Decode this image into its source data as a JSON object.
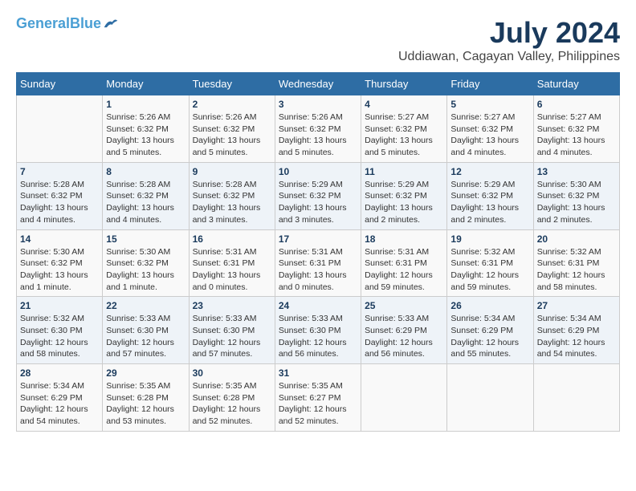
{
  "logo": {
    "line1": "General",
    "line2": "Blue"
  },
  "title": "July 2024",
  "subtitle": "Uddiawan, Cagayan Valley, Philippines",
  "header_days": [
    "Sunday",
    "Monday",
    "Tuesday",
    "Wednesday",
    "Thursday",
    "Friday",
    "Saturday"
  ],
  "weeks": [
    [
      {
        "day": "",
        "sunrise": "",
        "sunset": "",
        "daylight": ""
      },
      {
        "day": "1",
        "sunrise": "Sunrise: 5:26 AM",
        "sunset": "Sunset: 6:32 PM",
        "daylight": "Daylight: 13 hours and 5 minutes."
      },
      {
        "day": "2",
        "sunrise": "Sunrise: 5:26 AM",
        "sunset": "Sunset: 6:32 PM",
        "daylight": "Daylight: 13 hours and 5 minutes."
      },
      {
        "day": "3",
        "sunrise": "Sunrise: 5:26 AM",
        "sunset": "Sunset: 6:32 PM",
        "daylight": "Daylight: 13 hours and 5 minutes."
      },
      {
        "day": "4",
        "sunrise": "Sunrise: 5:27 AM",
        "sunset": "Sunset: 6:32 PM",
        "daylight": "Daylight: 13 hours and 5 minutes."
      },
      {
        "day": "5",
        "sunrise": "Sunrise: 5:27 AM",
        "sunset": "Sunset: 6:32 PM",
        "daylight": "Daylight: 13 hours and 4 minutes."
      },
      {
        "day": "6",
        "sunrise": "Sunrise: 5:27 AM",
        "sunset": "Sunset: 6:32 PM",
        "daylight": "Daylight: 13 hours and 4 minutes."
      }
    ],
    [
      {
        "day": "7",
        "sunrise": "Sunrise: 5:28 AM",
        "sunset": "Sunset: 6:32 PM",
        "daylight": "Daylight: 13 hours and 4 minutes."
      },
      {
        "day": "8",
        "sunrise": "Sunrise: 5:28 AM",
        "sunset": "Sunset: 6:32 PM",
        "daylight": "Daylight: 13 hours and 4 minutes."
      },
      {
        "day": "9",
        "sunrise": "Sunrise: 5:28 AM",
        "sunset": "Sunset: 6:32 PM",
        "daylight": "Daylight: 13 hours and 3 minutes."
      },
      {
        "day": "10",
        "sunrise": "Sunrise: 5:29 AM",
        "sunset": "Sunset: 6:32 PM",
        "daylight": "Daylight: 13 hours and 3 minutes."
      },
      {
        "day": "11",
        "sunrise": "Sunrise: 5:29 AM",
        "sunset": "Sunset: 6:32 PM",
        "daylight": "Daylight: 13 hours and 2 minutes."
      },
      {
        "day": "12",
        "sunrise": "Sunrise: 5:29 AM",
        "sunset": "Sunset: 6:32 PM",
        "daylight": "Daylight: 13 hours and 2 minutes."
      },
      {
        "day": "13",
        "sunrise": "Sunrise: 5:30 AM",
        "sunset": "Sunset: 6:32 PM",
        "daylight": "Daylight: 13 hours and 2 minutes."
      }
    ],
    [
      {
        "day": "14",
        "sunrise": "Sunrise: 5:30 AM",
        "sunset": "Sunset: 6:32 PM",
        "daylight": "Daylight: 13 hours and 1 minute."
      },
      {
        "day": "15",
        "sunrise": "Sunrise: 5:30 AM",
        "sunset": "Sunset: 6:32 PM",
        "daylight": "Daylight: 13 hours and 1 minute."
      },
      {
        "day": "16",
        "sunrise": "Sunrise: 5:31 AM",
        "sunset": "Sunset: 6:31 PM",
        "daylight": "Daylight: 13 hours and 0 minutes."
      },
      {
        "day": "17",
        "sunrise": "Sunrise: 5:31 AM",
        "sunset": "Sunset: 6:31 PM",
        "daylight": "Daylight: 13 hours and 0 minutes."
      },
      {
        "day": "18",
        "sunrise": "Sunrise: 5:31 AM",
        "sunset": "Sunset: 6:31 PM",
        "daylight": "Daylight: 12 hours and 59 minutes."
      },
      {
        "day": "19",
        "sunrise": "Sunrise: 5:32 AM",
        "sunset": "Sunset: 6:31 PM",
        "daylight": "Daylight: 12 hours and 59 minutes."
      },
      {
        "day": "20",
        "sunrise": "Sunrise: 5:32 AM",
        "sunset": "Sunset: 6:31 PM",
        "daylight": "Daylight: 12 hours and 58 minutes."
      }
    ],
    [
      {
        "day": "21",
        "sunrise": "Sunrise: 5:32 AM",
        "sunset": "Sunset: 6:30 PM",
        "daylight": "Daylight: 12 hours and 58 minutes."
      },
      {
        "day": "22",
        "sunrise": "Sunrise: 5:33 AM",
        "sunset": "Sunset: 6:30 PM",
        "daylight": "Daylight: 12 hours and 57 minutes."
      },
      {
        "day": "23",
        "sunrise": "Sunrise: 5:33 AM",
        "sunset": "Sunset: 6:30 PM",
        "daylight": "Daylight: 12 hours and 57 minutes."
      },
      {
        "day": "24",
        "sunrise": "Sunrise: 5:33 AM",
        "sunset": "Sunset: 6:30 PM",
        "daylight": "Daylight: 12 hours and 56 minutes."
      },
      {
        "day": "25",
        "sunrise": "Sunrise: 5:33 AM",
        "sunset": "Sunset: 6:29 PM",
        "daylight": "Daylight: 12 hours and 56 minutes."
      },
      {
        "day": "26",
        "sunrise": "Sunrise: 5:34 AM",
        "sunset": "Sunset: 6:29 PM",
        "daylight": "Daylight: 12 hours and 55 minutes."
      },
      {
        "day": "27",
        "sunrise": "Sunrise: 5:34 AM",
        "sunset": "Sunset: 6:29 PM",
        "daylight": "Daylight: 12 hours and 54 minutes."
      }
    ],
    [
      {
        "day": "28",
        "sunrise": "Sunrise: 5:34 AM",
        "sunset": "Sunset: 6:29 PM",
        "daylight": "Daylight: 12 hours and 54 minutes."
      },
      {
        "day": "29",
        "sunrise": "Sunrise: 5:35 AM",
        "sunset": "Sunset: 6:28 PM",
        "daylight": "Daylight: 12 hours and 53 minutes."
      },
      {
        "day": "30",
        "sunrise": "Sunrise: 5:35 AM",
        "sunset": "Sunset: 6:28 PM",
        "daylight": "Daylight: 12 hours and 52 minutes."
      },
      {
        "day": "31",
        "sunrise": "Sunrise: 5:35 AM",
        "sunset": "Sunset: 6:27 PM",
        "daylight": "Daylight: 12 hours and 52 minutes."
      },
      {
        "day": "",
        "sunrise": "",
        "sunset": "",
        "daylight": ""
      },
      {
        "day": "",
        "sunrise": "",
        "sunset": "",
        "daylight": ""
      },
      {
        "day": "",
        "sunrise": "",
        "sunset": "",
        "daylight": ""
      }
    ]
  ]
}
